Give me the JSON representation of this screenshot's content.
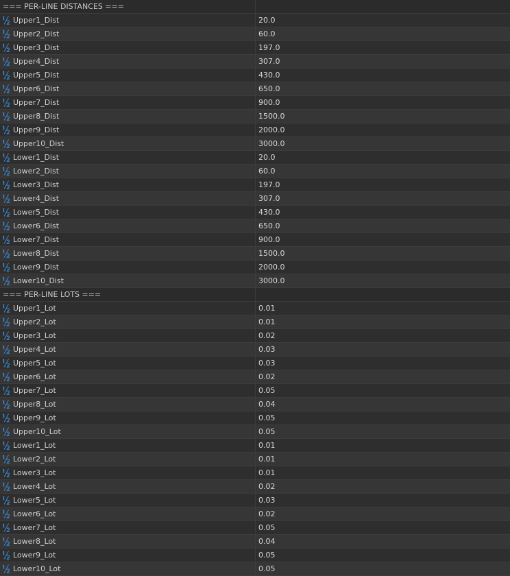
{
  "icon": "fraction-half-icon",
  "accent_color": "#3d8bd9",
  "rows": [
    {
      "type": "header",
      "label": "=== PER-LINE DISTANCES ===",
      "value": ""
    },
    {
      "type": "param",
      "label": "Upper1_Dist",
      "value": "20.0"
    },
    {
      "type": "param",
      "label": "Upper2_Dist",
      "value": "60.0"
    },
    {
      "type": "param",
      "label": "Upper3_Dist",
      "value": "197.0"
    },
    {
      "type": "param",
      "label": "Upper4_Dist",
      "value": "307.0"
    },
    {
      "type": "param",
      "label": "Upper5_Dist",
      "value": "430.0"
    },
    {
      "type": "param",
      "label": "Upper6_Dist",
      "value": "650.0"
    },
    {
      "type": "param",
      "label": "Upper7_Dist",
      "value": "900.0"
    },
    {
      "type": "param",
      "label": "Upper8_Dist",
      "value": "1500.0"
    },
    {
      "type": "param",
      "label": "Upper9_Dist",
      "value": "2000.0"
    },
    {
      "type": "param",
      "label": "Upper10_Dist",
      "value": "3000.0"
    },
    {
      "type": "param",
      "label": "Lower1_Dist",
      "value": "20.0"
    },
    {
      "type": "param",
      "label": "Lower2_Dist",
      "value": "60.0"
    },
    {
      "type": "param",
      "label": "Lower3_Dist",
      "value": "197.0"
    },
    {
      "type": "param",
      "label": "Lower4_Dist",
      "value": "307.0"
    },
    {
      "type": "param",
      "label": "Lower5_Dist",
      "value": "430.0"
    },
    {
      "type": "param",
      "label": "Lower6_Dist",
      "value": "650.0"
    },
    {
      "type": "param",
      "label": "Lower7_Dist",
      "value": "900.0"
    },
    {
      "type": "param",
      "label": "Lower8_Dist",
      "value": "1500.0"
    },
    {
      "type": "param",
      "label": "Lower9_Dist",
      "value": "2000.0"
    },
    {
      "type": "param",
      "label": "Lower10_Dist",
      "value": "3000.0"
    },
    {
      "type": "header",
      "label": "=== PER-LINE LOTS ===",
      "value": ""
    },
    {
      "type": "param",
      "label": "Upper1_Lot",
      "value": "0.01"
    },
    {
      "type": "param",
      "label": "Upper2_Lot",
      "value": "0.01"
    },
    {
      "type": "param",
      "label": "Upper3_Lot",
      "value": "0.02"
    },
    {
      "type": "param",
      "label": "Upper4_Lot",
      "value": "0.03"
    },
    {
      "type": "param",
      "label": "Upper5_Lot",
      "value": "0.03"
    },
    {
      "type": "param",
      "label": "Upper6_Lot",
      "value": "0.02"
    },
    {
      "type": "param",
      "label": "Upper7_Lot",
      "value": "0.05"
    },
    {
      "type": "param",
      "label": "Upper8_Lot",
      "value": "0.04"
    },
    {
      "type": "param",
      "label": "Upper9_Lot",
      "value": "0.05"
    },
    {
      "type": "param",
      "label": "Upper10_Lot",
      "value": "0.05"
    },
    {
      "type": "param",
      "label": "Lower1_Lot",
      "value": "0.01"
    },
    {
      "type": "param",
      "label": "Lower2_Lot",
      "value": "0.01"
    },
    {
      "type": "param",
      "label": "Lower3_Lot",
      "value": "0.01"
    },
    {
      "type": "param",
      "label": "Lower4_Lot",
      "value": "0.02"
    },
    {
      "type": "param",
      "label": "Lower5_Lot",
      "value": "0.03"
    },
    {
      "type": "param",
      "label": "Lower6_Lot",
      "value": "0.02"
    },
    {
      "type": "param",
      "label": "Lower7_Lot",
      "value": "0.05"
    },
    {
      "type": "param",
      "label": "Lower8_Lot",
      "value": "0.04"
    },
    {
      "type": "param",
      "label": "Lower9_Lot",
      "value": "0.05"
    },
    {
      "type": "param",
      "label": "Lower10_Lot",
      "value": "0.05"
    }
  ]
}
